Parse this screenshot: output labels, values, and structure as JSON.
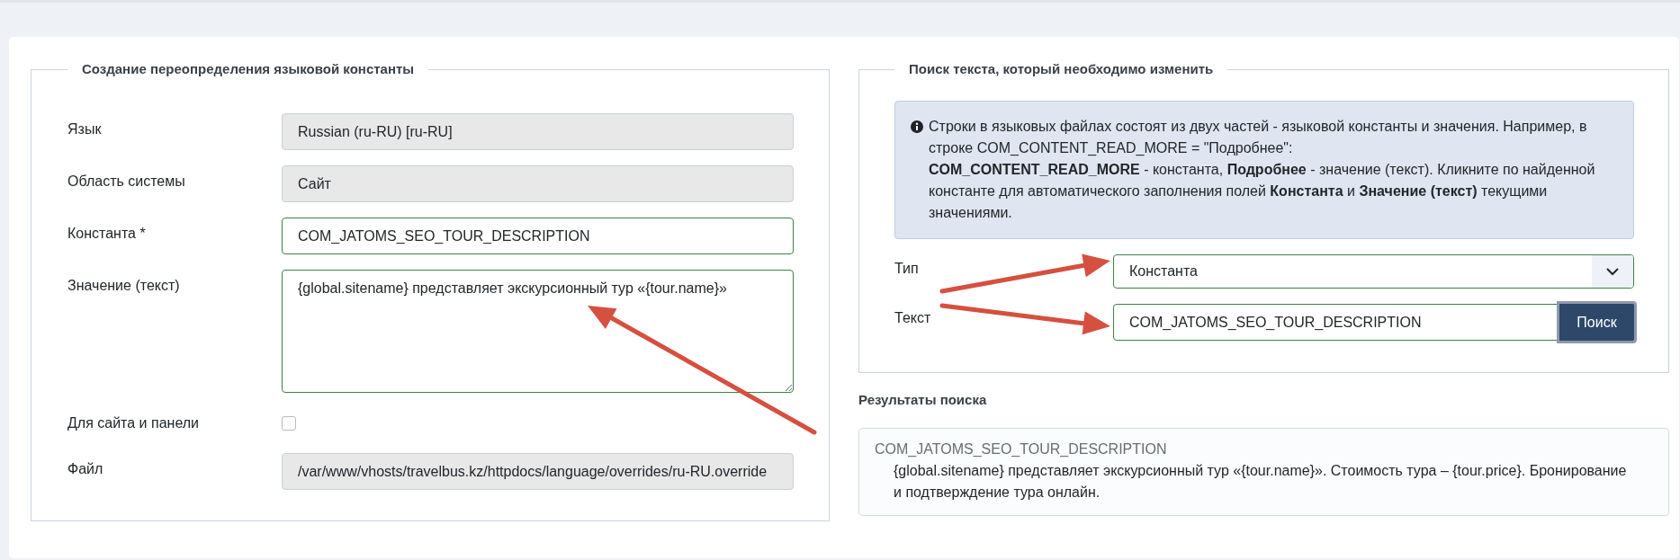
{
  "override_form": {
    "legend": "Создание переопределения языковой константы",
    "fields": [
      {
        "kind": "readonly",
        "label": "Язык",
        "value": "Russian (ru-RU) [ru-RU]",
        "valid": false
      },
      {
        "kind": "readonly",
        "label": "Область системы",
        "value": "Сайт",
        "valid": false
      },
      {
        "kind": "text",
        "label": "Константа *",
        "value": "COM_JATOMS_SEO_TOUR_DESCRIPTION",
        "valid": true
      },
      {
        "kind": "textarea",
        "label": "Значение (текст)",
        "value": "{global.sitename} представляет экскурсионный тур «{tour.name}»",
        "valid": true
      },
      {
        "kind": "checkbox",
        "label": "Для сайта и панели",
        "checked": false
      },
      {
        "kind": "readonly",
        "label": "Файл",
        "value": "/var/www/vhosts/travelbus.kz/httpdocs/language/overrides/ru-RU.override",
        "valid": false
      }
    ]
  },
  "search_panel": {
    "legend": "Поиск текста, который необходимо изменить",
    "info": [
      "Строки в языковых файлах состоят из двух частей - языковой константы и значения. Например, в строке COM_CONTENT_READ_MORE = \"Подробнее\":",
      "**COM_CONTENT_READ_MORE** - константа, **Подробнее** - значение (текст). Кликните по найденной константе для автоматического заполнения полей **Константа** и **Значение (текст)** текущими значениями."
    ],
    "type_field": {
      "label": "Тип",
      "value": "Константа",
      "valid": true
    },
    "text_field": {
      "label": "Текст",
      "value": "COM_JATOMS_SEO_TOUR_DESCRIPTION",
      "valid": true
    },
    "search_button": {
      "label": "Поиск",
      "focused": true
    }
  },
  "results": {
    "heading": "Результаты поиска",
    "items": [
      {
        "constant": "COM_JATOMS_SEO_TOUR_DESCRIPTION",
        "value": "{global.sitename} представляет экскурсионный тур «{tour.name}». Стоимость тура – {tour.price}. Бронирование и подтверждение тура онлайн."
      }
    ]
  }
}
